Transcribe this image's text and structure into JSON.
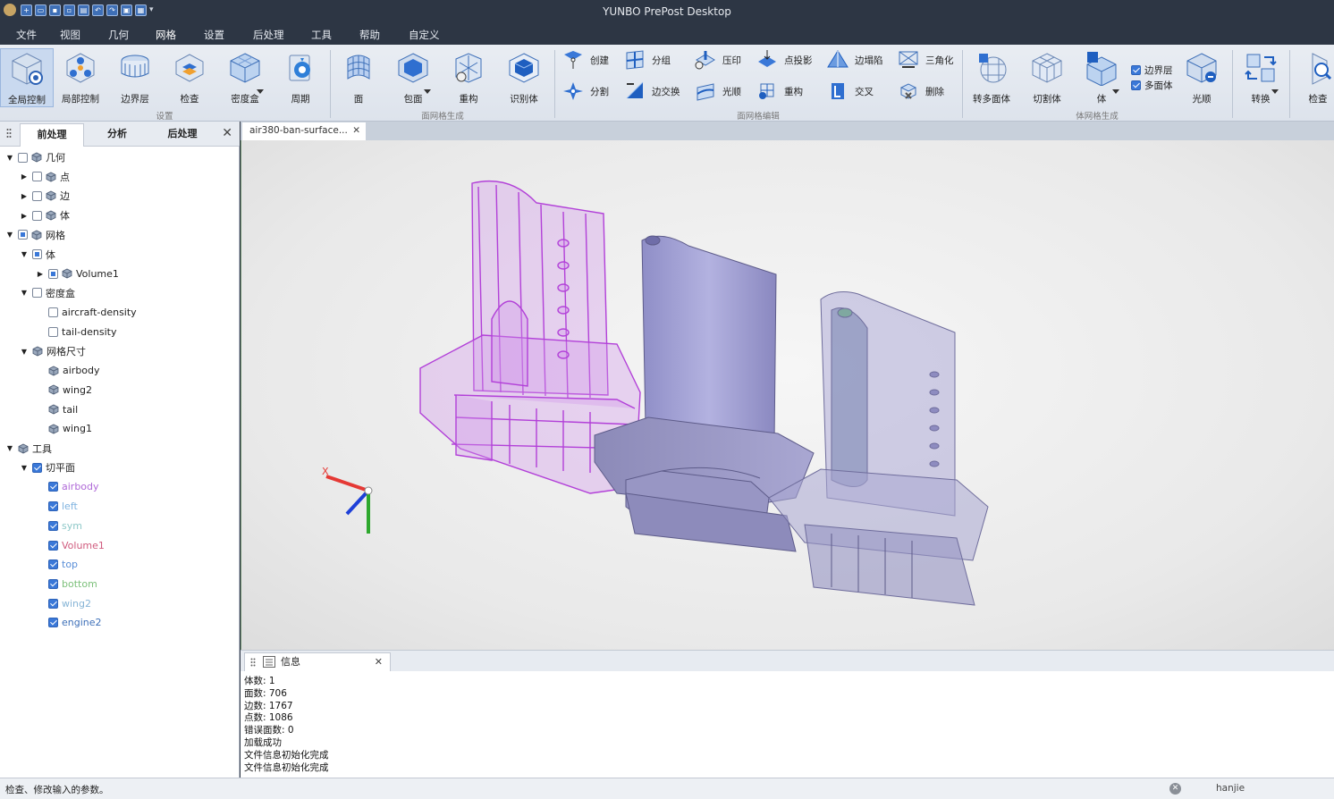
{
  "window": {
    "title": "YUNBO PrePost Desktop",
    "quick_access": [
      "new-file",
      "open-file",
      "save",
      "save-as",
      "print",
      "undo",
      "redo",
      "screenshot",
      "layout"
    ]
  },
  "menu": [
    "文件",
    "视图",
    "几何",
    "网格",
    "设置",
    "后处理",
    "工具",
    "帮助",
    "自定义"
  ],
  "menu_active": "网格",
  "ribbon": {
    "settings": {
      "group": "设置",
      "buttons": [
        {
          "label": "全局控制",
          "icon": "global-control-icon"
        },
        {
          "label": "局部控制",
          "icon": "local-control-icon"
        },
        {
          "label": "边界层",
          "icon": "boundary-layer-icon"
        },
        {
          "label": "检查",
          "icon": "check-icon"
        },
        {
          "label": "密度盒",
          "icon": "density-box-icon"
        },
        {
          "label": "周期",
          "icon": "periodic-icon"
        }
      ]
    },
    "surface_gen": {
      "group": "面网格生成",
      "buttons": [
        {
          "label": "面",
          "icon": "surface-icon"
        },
        {
          "label": "包面",
          "icon": "wrap-icon"
        },
        {
          "label": "重构",
          "icon": "rebuild-icon"
        },
        {
          "label": "识别体",
          "icon": "identify-volume-icon"
        }
      ]
    },
    "surface_edit": {
      "group": "面网格编辑",
      "buttons": [
        {
          "label": "创建",
          "icon": "create-icon"
        },
        {
          "label": "分组",
          "icon": "group-icon"
        },
        {
          "label": "压印",
          "icon": "imprint-icon"
        },
        {
          "label": "点投影",
          "icon": "point-project-icon"
        },
        {
          "label": "边塌陷",
          "icon": "edge-collapse-icon"
        },
        {
          "label": "三角化",
          "icon": "triangulate-icon"
        },
        {
          "label": "分割",
          "icon": "split-icon"
        },
        {
          "label": "边交换",
          "icon": "edge-swap-icon"
        },
        {
          "label": "光顺",
          "icon": "smooth-icon"
        },
        {
          "label": "重构",
          "icon": "remesh-icon"
        },
        {
          "label": "交叉",
          "icon": "intersect-icon"
        },
        {
          "label": "删除",
          "icon": "delete-icon"
        }
      ]
    },
    "volume_gen": {
      "group": "体网格生成",
      "buttons": [
        {
          "label": "转多面体",
          "icon": "to-polyhedra-icon"
        },
        {
          "label": "切割体",
          "icon": "cut-cell-icon"
        },
        {
          "label": "体",
          "icon": "volume-icon"
        },
        {
          "label": "光顺",
          "icon": "volume-smooth-icon"
        }
      ],
      "checks": [
        {
          "label": "边界层",
          "checked": true
        },
        {
          "label": "多面体",
          "checked": true
        }
      ]
    },
    "extra": [
      {
        "label": "转换",
        "icon": "convert-icon"
      },
      {
        "label": "检查",
        "icon": "inspect-icon"
      }
    ]
  },
  "left_panel": {
    "tabs": [
      "前处理",
      "分析",
      "后处理"
    ],
    "active_tab": "前处理",
    "tree": [
      {
        "label": "几何",
        "level": 0,
        "arrow": "down",
        "check": "off",
        "icon": "geometry-icon"
      },
      {
        "label": "点",
        "level": 1,
        "arrow": "right",
        "check": "off",
        "icon": "point-icon"
      },
      {
        "label": "边",
        "level": 1,
        "arrow": "right",
        "check": "off",
        "icon": "edge-icon"
      },
      {
        "label": "体",
        "level": 1,
        "arrow": "right",
        "check": "off",
        "icon": "body-icon"
      },
      {
        "label": "网格",
        "level": 0,
        "arrow": "down",
        "check": "partial",
        "icon": "mesh-icon"
      },
      {
        "label": "体",
        "level": 1,
        "arrow": "down",
        "check": "partial",
        "icon": ""
      },
      {
        "label": "Volume1",
        "level": 2,
        "arrow": "right",
        "check": "partial",
        "icon": "volume-node-icon"
      },
      {
        "label": "密度盒",
        "level": 1,
        "arrow": "down",
        "check": "off",
        "icon": ""
      },
      {
        "label": "aircraft-density",
        "level": 2,
        "arrow": "",
        "check": "off",
        "icon": ""
      },
      {
        "label": "tail-density",
        "level": 2,
        "arrow": "",
        "check": "off",
        "icon": ""
      },
      {
        "label": "网格尺寸",
        "level": 1,
        "arrow": "down",
        "check": "none",
        "icon": "mesh-size-icon"
      },
      {
        "label": "airbody",
        "level": 2,
        "arrow": "",
        "check": "none",
        "icon": "size-node-icon"
      },
      {
        "label": "wing2",
        "level": 2,
        "arrow": "",
        "check": "none",
        "icon": "size-node-icon"
      },
      {
        "label": "tail",
        "level": 2,
        "arrow": "",
        "check": "none",
        "icon": "size-node-icon"
      },
      {
        "label": "wing1",
        "level": 2,
        "arrow": "",
        "check": "none",
        "icon": "size-node-icon"
      },
      {
        "label": "工具",
        "level": 0,
        "arrow": "down",
        "check": "none",
        "icon": "tools-icon"
      },
      {
        "label": "切平面",
        "level": 1,
        "arrow": "down",
        "check": "on",
        "icon": ""
      },
      {
        "label": "airbody",
        "level": 2,
        "arrow": "",
        "check": "on",
        "icon": "",
        "color": "#b06ad8"
      },
      {
        "label": "left",
        "level": 2,
        "arrow": "",
        "check": "on",
        "icon": "",
        "color": "#7fb3e0"
      },
      {
        "label": "sym",
        "level": 2,
        "arrow": "",
        "check": "on",
        "icon": "",
        "color": "#8ec8c8"
      },
      {
        "label": "Volume1",
        "level": 2,
        "arrow": "",
        "check": "on",
        "icon": "",
        "color": "#d05b7e"
      },
      {
        "label": "top",
        "level": 2,
        "arrow": "",
        "check": "on",
        "icon": "",
        "color": "#5a8fd8"
      },
      {
        "label": "bottom",
        "level": 2,
        "arrow": "",
        "check": "on",
        "icon": "",
        "color": "#7cc07a"
      },
      {
        "label": "wing2",
        "level": 2,
        "arrow": "",
        "check": "on",
        "icon": "",
        "color": "#86b4d6"
      },
      {
        "label": "engine2",
        "level": 2,
        "arrow": "",
        "check": "on",
        "icon": "",
        "color": "#3d6fb8"
      }
    ]
  },
  "document_tab": "air380-ban-surface...",
  "info_panel": {
    "tab": "信息",
    "lines": [
      "体数: 1",
      "面数: 706",
      "边数: 1767",
      "点数: 1086",
      "错误面数: 0",
      "加载成功",
      "文件信息初始化完成",
      "文件信息初始化完成"
    ]
  },
  "status": {
    "message": "检查、修改输入的参数。",
    "user": "hanjie"
  }
}
